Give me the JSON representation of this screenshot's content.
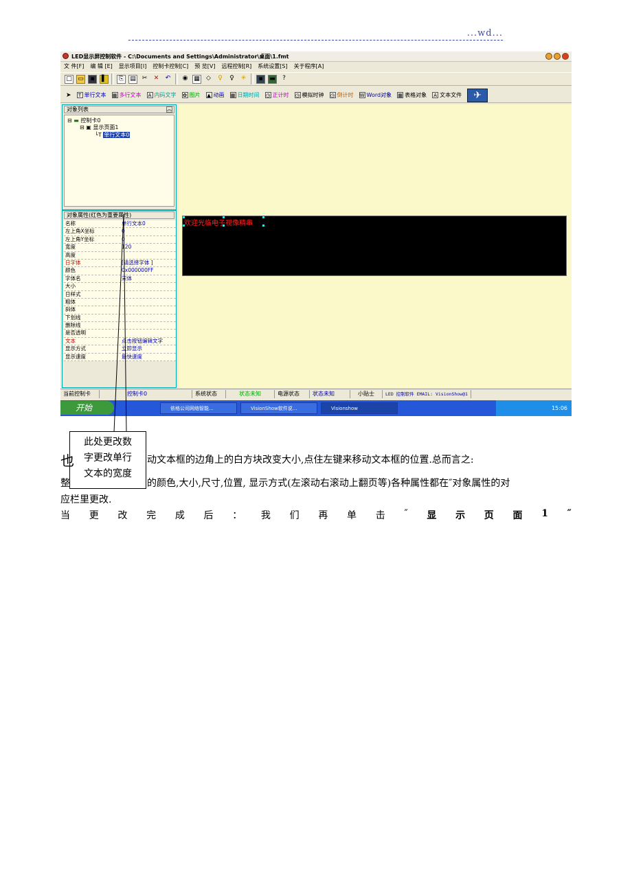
{
  "header": {
    "mark": "...wd..."
  },
  "app": {
    "title": "LED显示屏控制软件 - C:\\Documents and Settings\\Administrator\\桌面\\1.fmt",
    "menu": [
      "文 件[F]",
      "编 辑 [E]",
      "显示项目[I]",
      "控制卡控制[C]",
      "预 览[V]",
      "远程控制[R]",
      "系统设置[S]",
      "关于程序[A]"
    ],
    "toolbar2": [
      {
        "icon": "T",
        "label": "单行文本",
        "color": "#0000c0"
      },
      {
        "icon": "▦",
        "label": "多行文本",
        "color": "#c000c0"
      },
      {
        "icon": "A",
        "label": "内码文字",
        "color": "#00a0a0"
      },
      {
        "icon": "✿",
        "label": "图片",
        "color": "#00a000"
      },
      {
        "icon": "▲",
        "label": "动画",
        "color": "#0000c0"
      },
      {
        "icon": "▦",
        "label": "日期时间",
        "color": "#00a0a0"
      },
      {
        "icon": "◷",
        "label": "正计时",
        "color": "#c000c0"
      },
      {
        "icon": "◷",
        "label": "模拟时钟",
        "color": "#000000"
      },
      {
        "icon": "◷",
        "label": "倒计时",
        "color": "#c06000"
      },
      {
        "icon": "W",
        "label": "Word对象",
        "color": "#000080"
      },
      {
        "icon": "▦",
        "label": "表格对象",
        "color": "#000000"
      },
      {
        "icon": "A",
        "label": "文本文件",
        "color": "#000000"
      }
    ],
    "tree": {
      "header": "对象列表",
      "card": "控制卡0",
      "page": "显示页面1",
      "item": "单行文本0"
    },
    "props": {
      "header": "对象属性(红色为重要属性)",
      "rows": [
        {
          "k": "名称",
          "v": "单行文本0"
        },
        {
          "k": "左上角X坐标",
          "v": "0"
        },
        {
          "k": "左上角Y坐标",
          "v": "0"
        },
        {
          "k": "宽度",
          "v": "120"
        },
        {
          "k": "高度",
          "v": ""
        },
        {
          "k": "日字体",
          "v": "[请选择字体 ]",
          "red": true
        },
        {
          "k": "  颜色",
          "v": "0x000000FF"
        },
        {
          "k": "  字体名",
          "v": "宋体"
        },
        {
          "k": "  大小",
          "v": ""
        },
        {
          "k": "日样式",
          "v": ""
        },
        {
          "k": "    粗体",
          "v": ""
        },
        {
          "k": "    斜体",
          "v": ""
        },
        {
          "k": "    下划线",
          "v": ""
        },
        {
          "k": "    删除线",
          "v": ""
        },
        {
          "k": "是否透明",
          "v": ""
        },
        {
          "k": "文本",
          "v": "点击按钮编辑文字",
          "red": true
        },
        {
          "k": "显示方式",
          "v": "立即显示"
        },
        {
          "k": "显示速度",
          "v": "最快速度"
        }
      ]
    },
    "led_text": "欢迎光临电子视像精串",
    "status": [
      "当前控制卡",
      "控制卡0",
      "系统状态",
      "状态未知",
      "电源状态",
      "状态未知",
      "小贴士",
      "LED 控制软件 EMAIL: VisionShow@1"
    ],
    "taskbar": {
      "start": "开始",
      "items": [
        "依格公司网络智能...",
        "VisionShow软件说...",
        "Visionshow"
      ],
      "time": "15:06"
    }
  },
  "callout": [
    "此处更改数",
    "字更改单行",
    "文本的宽度"
  ],
  "body": {
    "line1_big": "也",
    "line1": "动文本框的边角上的白方块改变大小,点住左键来移动文本框的位置.总而言之:",
    "line2_start": "整",
    "line2": "的颜色,大小,尺寸,位置,  显示方式(左滚动右滚动上翻页等)各种属性都在″对象属性的对",
    "line3": "应栏里更改.",
    "line4": [
      "当",
      "更",
      "改",
      "完",
      "成",
      "后",
      "：",
      "我",
      "们",
      "再",
      "单",
      "击",
      "″",
      "显",
      "示",
      "页",
      "面",
      "1",
      "″"
    ]
  }
}
